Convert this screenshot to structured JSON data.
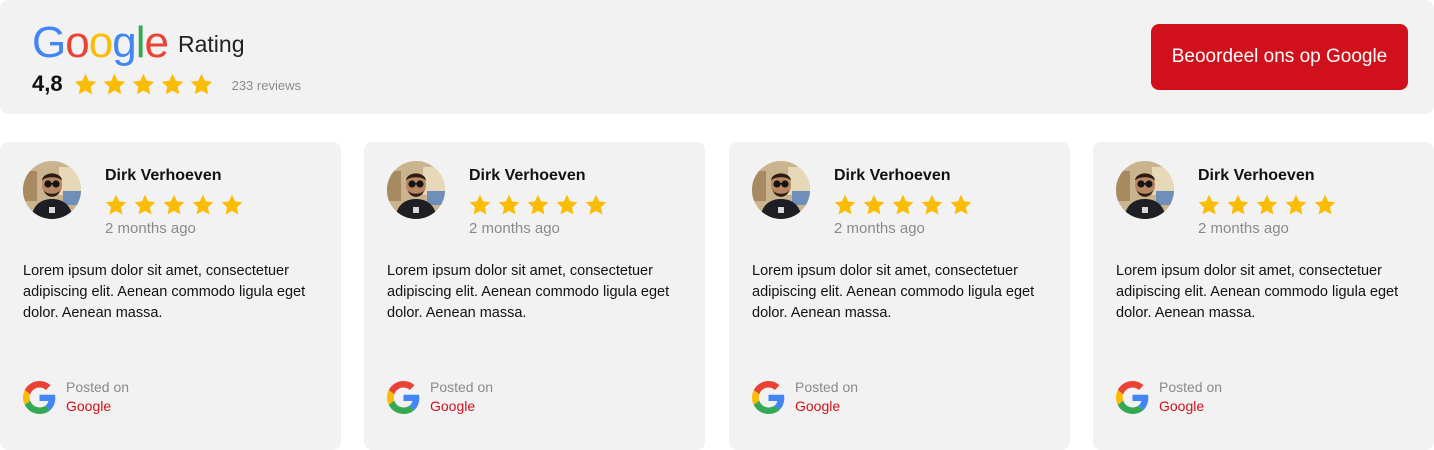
{
  "header": {
    "logo_text": [
      "G",
      "o",
      "o",
      "g",
      "l",
      "e"
    ],
    "logo_colors": [
      "#4285F4",
      "#EA4335",
      "#FBBC05",
      "#4285F4",
      "#34A853",
      "#EA4335"
    ],
    "rating_label": "Rating",
    "score": "4,8",
    "stars": 5,
    "reviews_count": "233 reviews",
    "cta_label": "Beoordeel ons op Google"
  },
  "colors": {
    "star": "#FBBC05",
    "accent": "#d0111b",
    "card_bg": "#f2f2f2"
  },
  "reviews": [
    {
      "name": "Dirk Verhoeven",
      "stars": 5,
      "date": "2 months ago",
      "text": "Lorem ipsum dolor sit amet, consectetuer adipiscing elit. Aenean commodo ligula eget dolor. Aenean massa.",
      "posted_label": "Posted on",
      "posted_source": "Google"
    },
    {
      "name": "Dirk Verhoeven",
      "stars": 5,
      "date": "2 months ago",
      "text": "Lorem ipsum dolor sit amet, consectetuer adipiscing elit. Aenean commodo ligula eget dolor. Aenean massa.",
      "posted_label": "Posted on",
      "posted_source": "Google"
    },
    {
      "name": "Dirk Verhoeven",
      "stars": 5,
      "date": "2 months ago",
      "text": "Lorem ipsum dolor sit amet, consectetuer adipiscing elit. Aenean commodo ligula eget dolor. Aenean massa.",
      "posted_label": "Posted on",
      "posted_source": "Google"
    },
    {
      "name": "Dirk Verhoeven",
      "stars": 5,
      "date": "2 months ago",
      "text": "Lorem ipsum dolor sit amet, consectetuer adipiscing elit. Aenean commodo ligula eget dolor. Aenean massa.",
      "posted_label": "Posted on",
      "posted_source": "Google"
    }
  ]
}
